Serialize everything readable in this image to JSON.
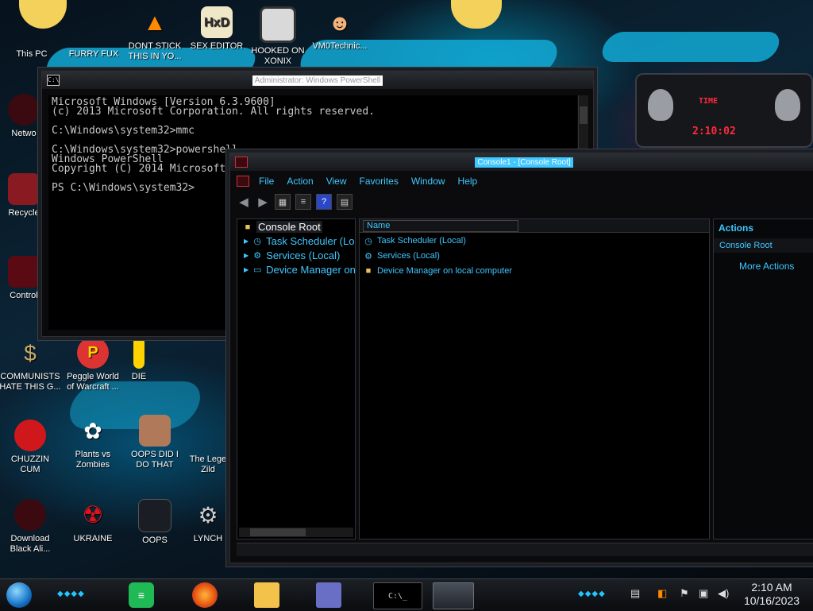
{
  "desktop": {
    "icons_top": [
      {
        "label": "This PC",
        "glyph": "computer-icon"
      },
      {
        "label": "FURRY FUX",
        "glyph": "app-icon"
      },
      {
        "label": "DONT STICK\nTHIS IN YO...",
        "glyph": "vlc-cone-icon"
      },
      {
        "label": "SEX EDITOR",
        "glyph": "hxd-icon"
      },
      {
        "label": "HOOKED ON\nXONIX",
        "glyph": "xonix-icon"
      },
      {
        "label": "VM0Technic...",
        "glyph": "doctor-icon"
      }
    ],
    "icons_left": [
      {
        "label": "Netwo",
        "glyph": "network-icon"
      },
      {
        "label": "Recycle",
        "glyph": "recycle-bin-icon"
      },
      {
        "label": "Control",
        "glyph": "control-panel-icon"
      }
    ],
    "icons_bottom": [
      {
        "label": "COMMUNISTS\nHATE THIS G...",
        "glyph": "money-bag-icon"
      },
      {
        "label": "Peggle World\nof Warcraft ...",
        "glyph": "peggle-icon"
      },
      {
        "label": "DIE",
        "glyph": "app-icon"
      },
      {
        "label": "CHUZZIN\nCUM",
        "glyph": "chuzzle-icon"
      },
      {
        "label": "Plants vs\nZombies",
        "glyph": "flower-icon"
      },
      {
        "label": "OOPS DID I\nDO THAT",
        "glyph": "person-icon"
      },
      {
        "label": "The Lege\nZild",
        "glyph": "app-icon"
      },
      {
        "label": "Download\nBlack Ali...",
        "glyph": "alien-icon"
      },
      {
        "label": "UKRAINE",
        "glyph": "radiation-icon"
      },
      {
        "label": "OOPS",
        "glyph": "app-icon"
      },
      {
        "label": "LYNCH",
        "glyph": "gear-icon"
      }
    ]
  },
  "clock_widget": {
    "label": "TIME",
    "time": "2:10:02"
  },
  "powershell": {
    "title": "Administrator: Windows PowerShell",
    "lines": "Microsoft Windows [Version 6.3.9600]\n(c) 2013 Microsoft Corporation. All rights reserved.\n\nC:\\Windows\\system32>mmc\n\nC:\\Windows\\system32>powershell\nWindows PowerShell\nCopyright (C) 2014 Microsoft Corporation. All rights reserved.\n\nPS C:\\Windows\\system32>"
  },
  "mmc": {
    "title": "Console1 - [Console Root]",
    "menu": [
      "File",
      "Action",
      "View",
      "Favorites",
      "Window",
      "Help"
    ],
    "tree": {
      "root": "Console Root",
      "items": [
        "Task Scheduler (Local)",
        "Services (Local)",
        "Device Manager on local computer"
      ]
    },
    "list": {
      "column_name": "Name",
      "items": [
        "Task Scheduler (Local)",
        "Services (Local)",
        "Device Manager on local computer"
      ]
    },
    "actions": {
      "header": "Actions",
      "section": "Console Root",
      "more": "More Actions"
    }
  },
  "taskbar": {
    "time": "2:10 AM",
    "date": "10/16/2023",
    "apps": [
      "start-orb-icon",
      "notes-icon",
      "firefox-icon",
      "file-explorer-icon",
      "app-icon",
      "powershell-icon",
      "mmc-icon"
    ]
  }
}
